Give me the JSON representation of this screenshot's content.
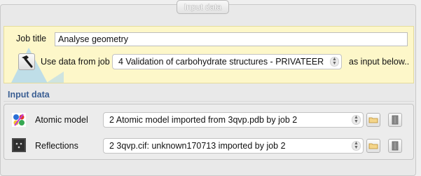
{
  "tab": {
    "label": "Input data"
  },
  "job": {
    "title_label": "Job title",
    "title_value": "Analyse geometry",
    "use_data_label": "Use data from job",
    "source_job": "4 Validation of carbohydrate structures - PRIVATEER",
    "as_input_label": "as input below.."
  },
  "input_data": {
    "section_title": "Input data",
    "rows": [
      {
        "label": "Atomic model",
        "value": "2 Atomic model imported from 3qvp.pdb by job 2",
        "icon": "atomic-model-icon"
      },
      {
        "label": "Reflections",
        "value": "2 3qvp.cif: unknown170713 imported by job 2",
        "icon": "reflections-icon"
      }
    ]
  },
  "colors": {
    "highlight_bg": "#fdf7c9",
    "section_title": "#3b5f93"
  }
}
